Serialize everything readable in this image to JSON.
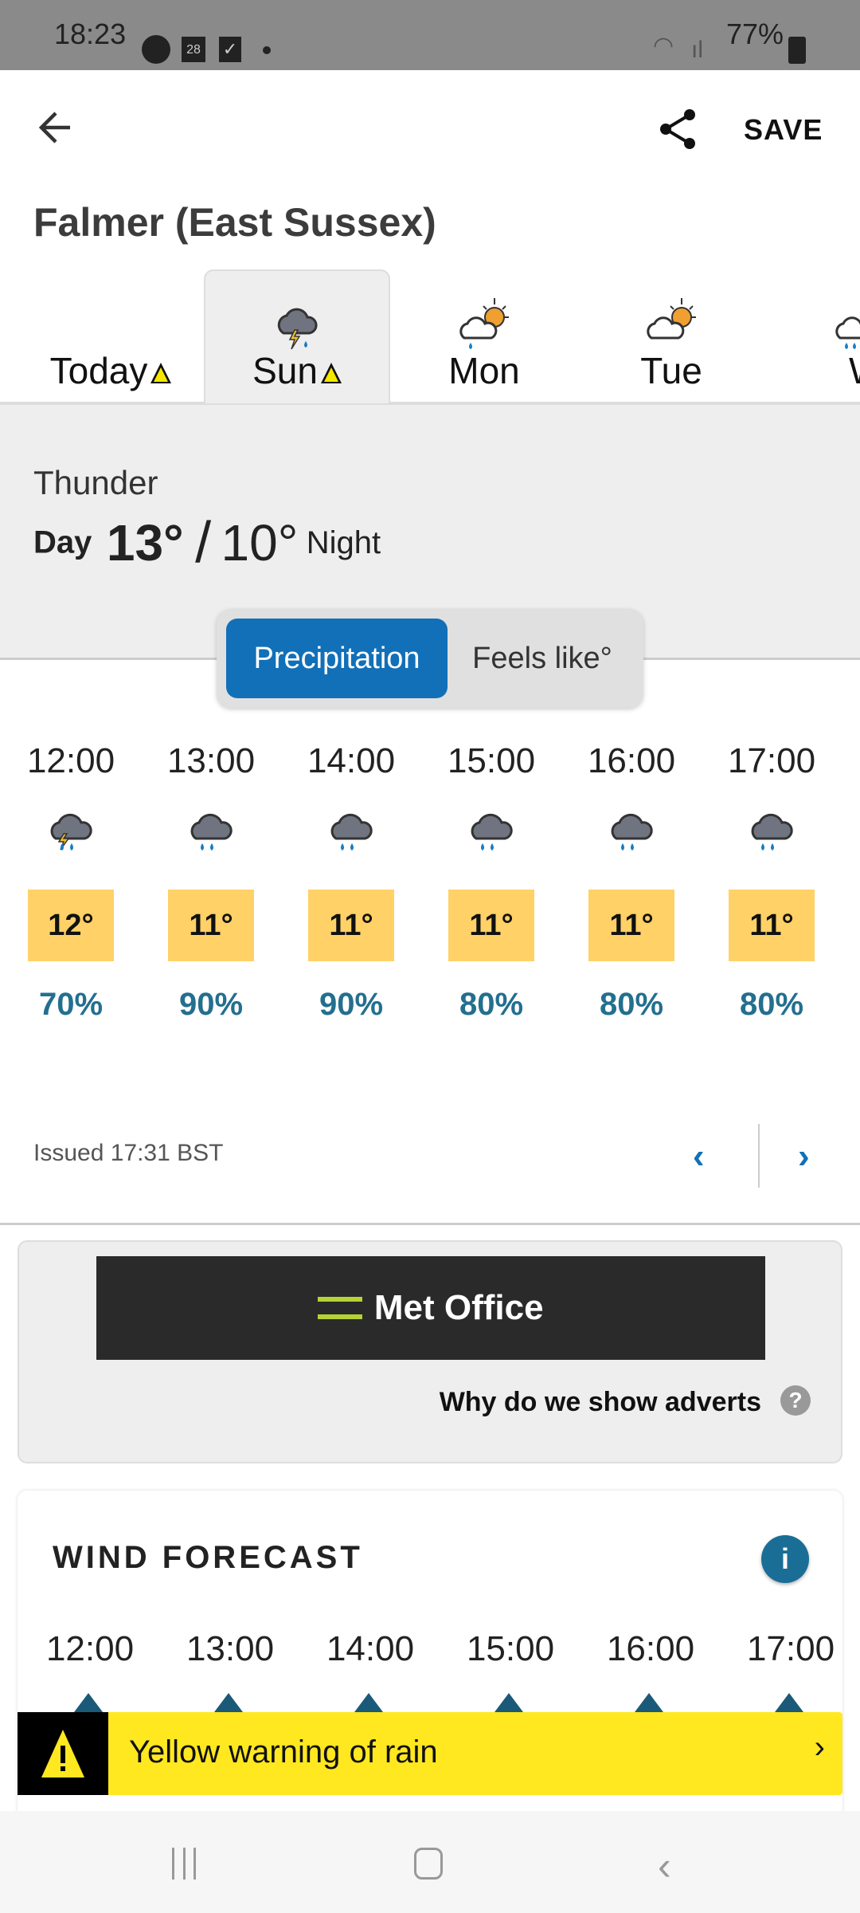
{
  "status_bar": {
    "time": "18:23",
    "calendar_day": "28",
    "battery": "77%"
  },
  "header": {
    "save_label": "SAVE",
    "location": "Falmer (East Sussex)"
  },
  "day_tabs": [
    {
      "label": "Today",
      "warning": true,
      "icon": "none"
    },
    {
      "label": "Sun",
      "warning": true,
      "icon": "thunder-rain",
      "selected": true
    },
    {
      "label": "Mon",
      "icon": "sun-cloud-rain"
    },
    {
      "label": "Tue",
      "icon": "sun-cloud"
    },
    {
      "label": "We",
      "icon": "cloud-heavy-rain"
    }
  ],
  "summary": {
    "condition": "Thunder",
    "day_label": "Day",
    "day_temp": "13°",
    "separator": "/",
    "night_temp": "10°",
    "night_label": "Night"
  },
  "toggle": {
    "options": [
      "Precipitation",
      "Feels like°"
    ],
    "selected": "Precipitation"
  },
  "hourly": [
    {
      "time": "12:00",
      "icon": "thunder-rain",
      "temp": "12°",
      "precip": "70%"
    },
    {
      "time": "13:00",
      "icon": "heavy-rain",
      "temp": "11°",
      "precip": "90%"
    },
    {
      "time": "14:00",
      "icon": "heavy-rain",
      "temp": "11°",
      "precip": "90%"
    },
    {
      "time": "15:00",
      "icon": "heavy-rain",
      "temp": "11°",
      "precip": "80%"
    },
    {
      "time": "16:00",
      "icon": "heavy-rain",
      "temp": "11°",
      "precip": "80%"
    },
    {
      "time": "17:00",
      "icon": "heavy-rain",
      "temp": "11°",
      "precip": "80%"
    }
  ],
  "issued": "Issued 17:31 BST",
  "ad": {
    "brand": "Met Office",
    "why": "Why do we show adverts",
    "help": "?"
  },
  "wind": {
    "title": "WIND FORECAST",
    "info": "i",
    "hours": [
      "12:00",
      "13:00",
      "14:00",
      "15:00",
      "16:00",
      "17:00"
    ]
  },
  "warning": {
    "text": "Yellow warning of rain",
    "chevron": "›"
  },
  "colors": {
    "accent": "#1170b8",
    "temp_box": "#ffd166",
    "precip": "#236f8e",
    "warning": "#ffe820"
  }
}
